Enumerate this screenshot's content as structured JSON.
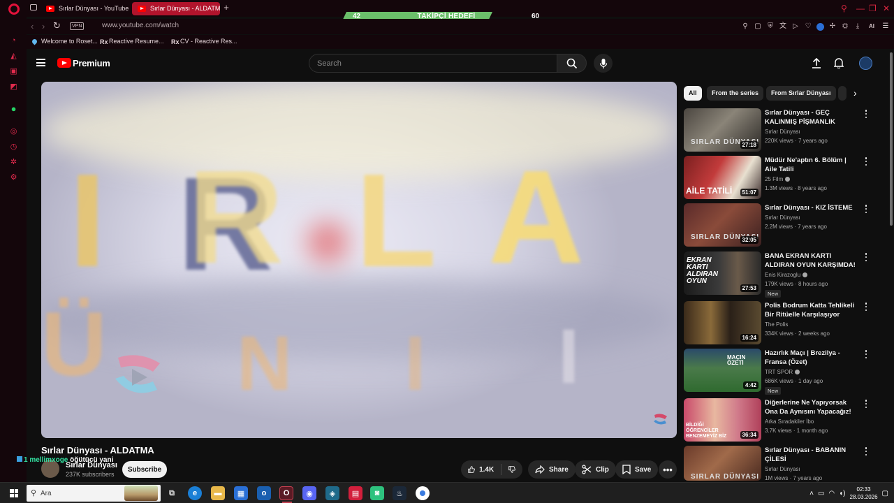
{
  "browser": {
    "tabs": [
      {
        "label": "Sırlar Dünyası - YouTube",
        "active": false
      },
      {
        "label": "Sırlar Dünyası - ALDATMA",
        "active": true
      }
    ],
    "new_tab": "+",
    "url": "www.youtube.com/watch",
    "vpn_label": "VPN",
    "ai_label": "AI",
    "bookmarks": [
      "Welcome to Roset...",
      "Reactive Resume...",
      "CV - Reactive Res..."
    ],
    "bookmark_rx": "Rx"
  },
  "overlay": {
    "goal_start": "42",
    "goal_title": "TAKİPÇİ HEDEFİ",
    "goal_end": "60",
    "goal_progress": 0.64,
    "chat_user": "mellimxoge",
    "chat_message": "öğütücü yani",
    "chat_badge_count": "1"
  },
  "header": {
    "brand": "Premium",
    "search_placeholder": "Search"
  },
  "video": {
    "title": "Sırlar Dünyası - ALDATMA",
    "channel": "Sırlar Dünyası",
    "subscribers": "237K subscribers",
    "subscribe_label": "Subscribe",
    "likes": "1.4K",
    "share_label": "Share",
    "clip_label": "Clip",
    "save_label": "Save"
  },
  "chips": [
    "All",
    "From the series",
    "From Sırlar Dünyası"
  ],
  "recommendations": [
    {
      "title": "Sırlar Dünyası - GEÇ KALINMIŞ PİŞMANLIK",
      "channel": "Sırlar Dünyası",
      "meta": "220K views · 7 years ago",
      "duration": "27:18",
      "verified": false,
      "is_new": false,
      "overlay": "SIRLAR DÜNYASI"
    },
    {
      "title": "Müdür Ne'aptın 6. Bölüm | Aile Tatili",
      "channel": "25 Film",
      "meta": "1.3M views · 8 years ago",
      "duration": "51:07",
      "verified": true,
      "is_new": false,
      "overlay": "AİLE TATİLİ"
    },
    {
      "title": "Sırlar Dünyası - KIZ İSTEME",
      "channel": "Sırlar Dünyası",
      "meta": "2.2M views · 7 years ago",
      "duration": "32:05",
      "verified": false,
      "is_new": false,
      "overlay": "SIRLAR DÜNYASI"
    },
    {
      "title": "BANA EKRAN KARTI ALDIRAN OYUN KARŞIMDA!",
      "channel": "Enis Kirazoglu",
      "meta": "179K views · 8 hours ago",
      "duration": "27:53",
      "verified": true,
      "is_new": true,
      "overlay": "EKRAN KARTI ALDIRAN OYUN"
    },
    {
      "title": "Polis Bodrum Katta Tehlikeli Bir Ritüelle Karşılaşıyor",
      "channel": "The Polis",
      "meta": "334K views · 2 weeks ago",
      "duration": "16:24",
      "verified": false,
      "is_new": false,
      "overlay": ""
    },
    {
      "title": "Hazırlık Maçı | Brezilya - Fransa (Özet)",
      "channel": "TRT SPOR",
      "meta": "686K views · 1 day ago",
      "duration": "4:42",
      "verified": true,
      "is_new": true,
      "overlay": "MAÇIN ÖZETİ"
    },
    {
      "title": "Diğerlerine Ne Yapıyorsak Ona Da Aynısını Yapacağız!",
      "channel": "Arka Sıradakiler İbo",
      "meta": "3.7K views · 1 month ago",
      "duration": "36:34",
      "verified": false,
      "is_new": false,
      "overlay": "BİLDİĞİ ÖĞRENCİLER BENZEMEYİZ BİZ"
    },
    {
      "title": "Sırlar Dünyası - BABANIN ÇİLESİ",
      "channel": "Sırlar Dünyası",
      "meta": "1M views · 7 years ago",
      "duration": "",
      "verified": false,
      "is_new": false,
      "overlay": "SIRLAR DÜNYASI"
    }
  ],
  "new_badge_label": "New",
  "taskbar": {
    "search_placeholder": "Ara",
    "time": "02:33",
    "date": "28.03.2026"
  },
  "colors": {
    "accent_red": "#ff0000",
    "opera_red": "#e3123b",
    "goal_green": "#6bbf6a",
    "chat_user": "#33e0a0"
  }
}
